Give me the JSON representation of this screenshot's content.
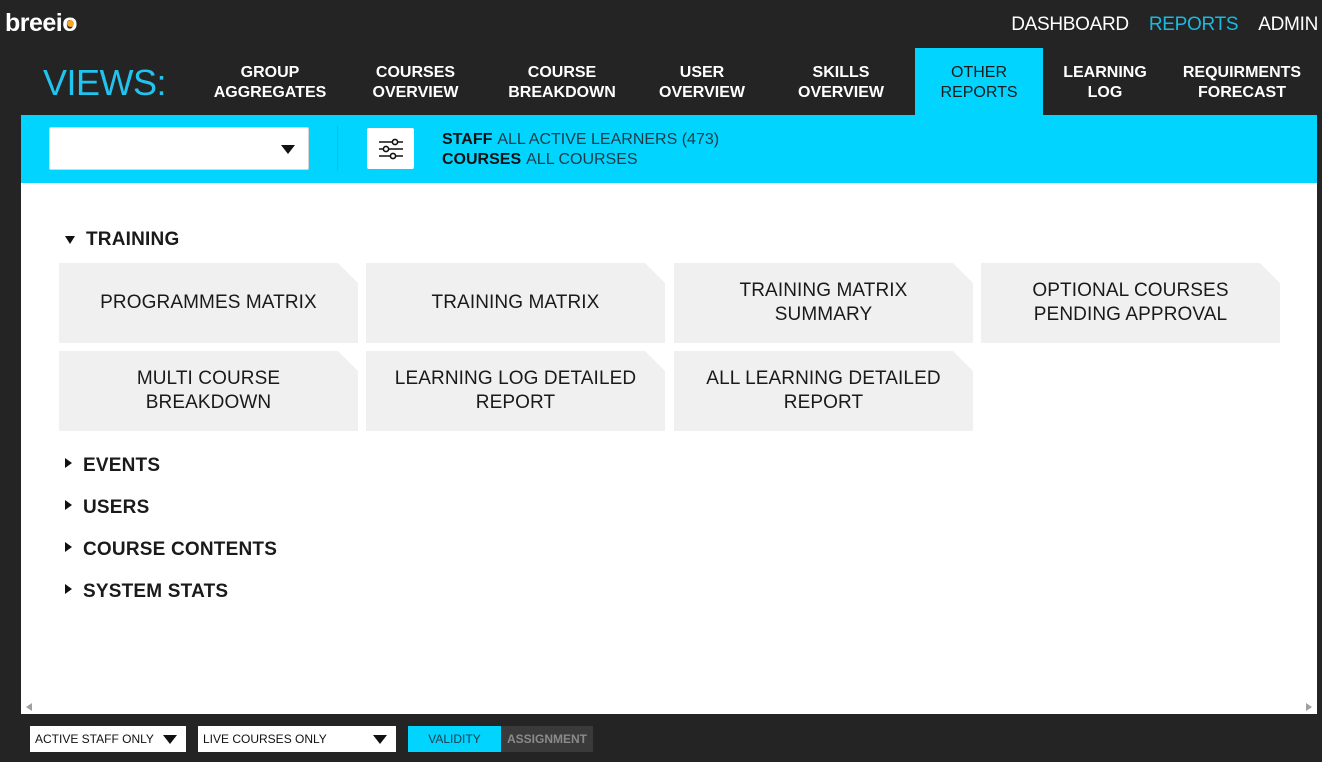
{
  "app": {
    "logo": "breeio"
  },
  "topnav": [
    {
      "label": "DASHBOARD",
      "active": false
    },
    {
      "label": "REPORTS",
      "active": true
    },
    {
      "label": "ADMIN",
      "active": false
    }
  ],
  "views": {
    "label": "VIEWS:",
    "tabs": [
      {
        "label": "GROUP\nAGGREGATES"
      },
      {
        "label": "COURSES\nOVERVIEW"
      },
      {
        "label": "COURSE\nBREAKDOWN"
      },
      {
        "label": "USER\nOVERVIEW"
      },
      {
        "label": "SKILLS\nOVERVIEW"
      },
      {
        "label": "OTHER\nREPORTS"
      },
      {
        "label": "LEARNING\nLOG"
      },
      {
        "label": "REQUIRMENTS\nFORECAST"
      }
    ],
    "active_tab": "OTHER REPORTS"
  },
  "filterbar": {
    "select_value": "",
    "filter_icon": "sliders-icon",
    "staff_label": "STAFF",
    "staff_value": "ALL ACTIVE LEARNERS (473)",
    "courses_label": "COURSES",
    "courses_value": "ALL COURSES"
  },
  "sections": {
    "training": {
      "label": "TRAINING",
      "expanded": true,
      "cards": [
        {
          "label": "PROGRAMMES MATRIX"
        },
        {
          "label": "TRAINING MATRIX"
        },
        {
          "label": "TRAINING MATRIX\nSUMMARY"
        },
        {
          "label": "OPTIONAL COURSES\nPENDING APPROVAL"
        },
        {
          "label": "MULTI COURSE\nBREAKDOWN"
        },
        {
          "label": "LEARNING LOG DETAILED\nREPORT"
        },
        {
          "label": "ALL LEARNING DETAILED\nREPORT"
        }
      ]
    },
    "events": {
      "label": "EVENTS",
      "expanded": false
    },
    "users": {
      "label": "USERS",
      "expanded": false
    },
    "course_contents": {
      "label": "COURSE CONTENTS",
      "expanded": false
    },
    "system_stats": {
      "label": "SYSTEM STATS",
      "expanded": false
    }
  },
  "bottombar": {
    "staff_filter": "ACTIVE STAFF ONLY",
    "course_filter": "LIVE COURSES ONLY",
    "toggle_on": "VALIDITY",
    "toggle_off": "ASSIGNMENT"
  },
  "colors": {
    "accent": "#00d4ff",
    "nav_active": "#1bb8e0",
    "background": "#242424",
    "logo_dot": "#f5a623"
  }
}
